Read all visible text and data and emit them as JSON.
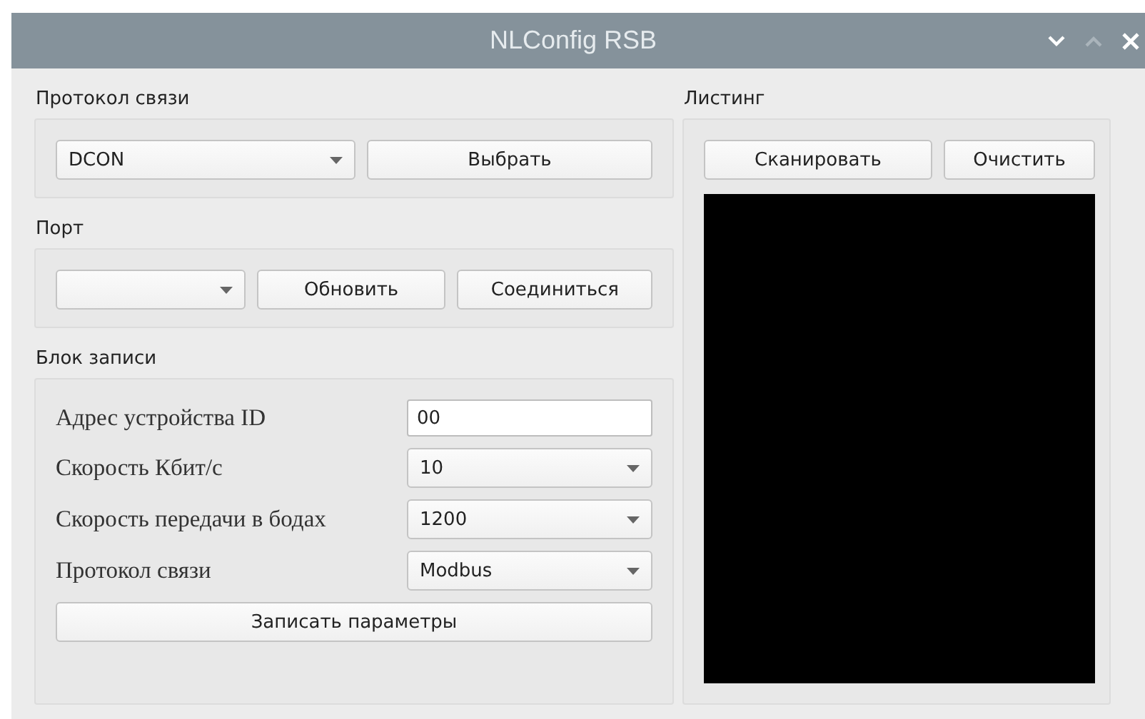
{
  "window": {
    "title": "NLConfig RSB"
  },
  "protocol": {
    "title": "Протокол связи",
    "combo": {
      "value": "DCON"
    },
    "button": "Выбрать"
  },
  "port": {
    "title": "Порт",
    "buttons": [
      "Обновить",
      "Соединиться"
    ]
  },
  "write_block": {
    "title": "Блок записи",
    "rows": [
      {
        "kind": "input",
        "label": "Адрес устройства ID",
        "value": "00"
      },
      {
        "kind": "combo",
        "label": "Скорость Кбит/с",
        "value": "10"
      },
      {
        "kind": "combo",
        "label": "Скорость передачи в бодах",
        "value": "1200"
      },
      {
        "kind": "combo",
        "label": "Протокол связи",
        "value": "Modbus"
      }
    ],
    "button": "Записать параметры"
  },
  "listing": {
    "title": "Листинг",
    "buttons": [
      "Сканировать",
      "Очистить"
    ]
  }
}
